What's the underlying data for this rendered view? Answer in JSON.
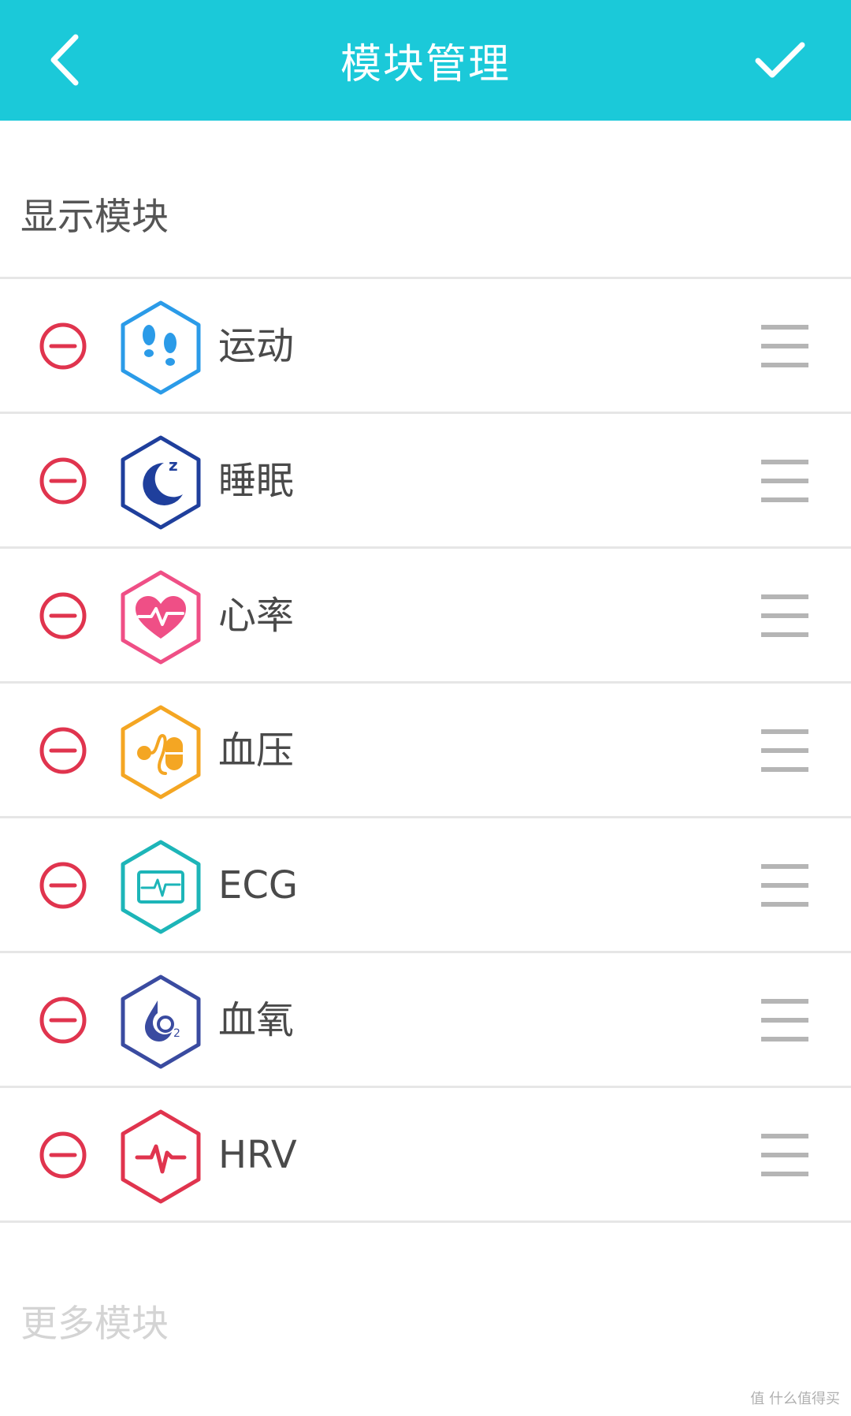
{
  "header": {
    "title": "模块管理",
    "back_icon": "chevron-left-icon",
    "confirm_icon": "check-icon",
    "bg_color": "#1BC9D9"
  },
  "sections": {
    "shown_title": "显示模块",
    "more_title": "更多模块"
  },
  "modules": [
    {
      "label": "运动",
      "icon": "footprints-icon",
      "color": "#2B9BE8"
    },
    {
      "label": "睡眠",
      "icon": "moon-sleep-icon",
      "color": "#1F3F9C"
    },
    {
      "label": "心率",
      "icon": "heart-rate-icon",
      "color": "#EF4F86"
    },
    {
      "label": "血压",
      "icon": "blood-pressure-icon",
      "color": "#F4A623"
    },
    {
      "label": "ECG",
      "icon": "ecg-monitor-icon",
      "color": "#1DB5B8"
    },
    {
      "label": "血氧",
      "icon": "blood-oxygen-icon",
      "color": "#3A4BA0"
    },
    {
      "label": "HRV",
      "icon": "hrv-pulse-icon",
      "color": "#E0344E"
    }
  ],
  "row_controls": {
    "remove_icon": "minus-circle-icon",
    "remove_color": "#E0344E",
    "drag_icon": "drag-handle-icon",
    "drag_color": "#b5b5b5"
  },
  "watermark": "值 什么值得买"
}
